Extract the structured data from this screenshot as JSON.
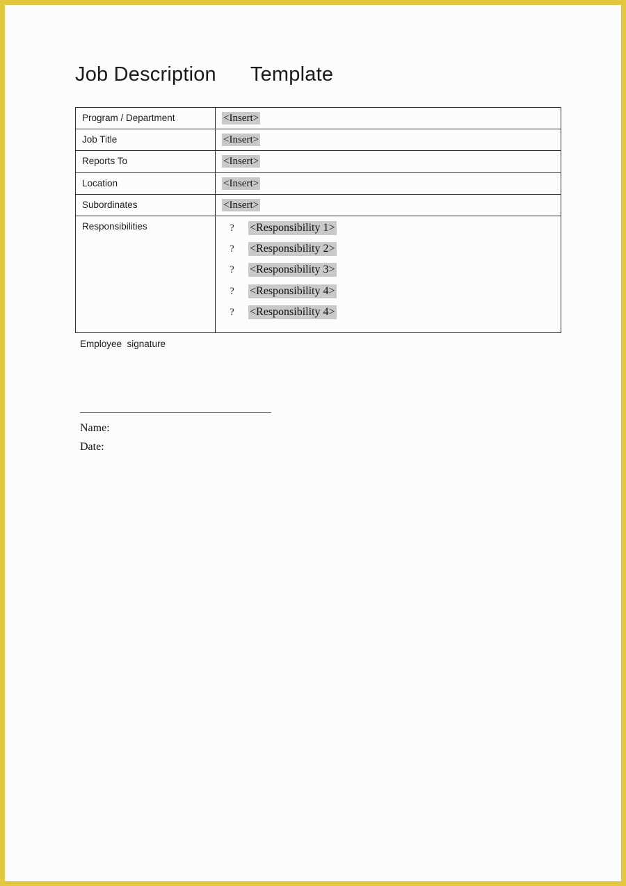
{
  "document": {
    "title": "Job Description      Template",
    "page_background": "#fcfcfc",
    "border_color": "#e3c83f",
    "highlight_color": "#c9c9c9"
  },
  "table": {
    "rows": [
      {
        "label": "Program / Department",
        "value": "<Insert>"
      },
      {
        "label": "Job Title",
        "value": "<Insert>"
      },
      {
        "label": "Reports To",
        "value": "<Insert>"
      },
      {
        "label": "Location",
        "value": "<Insert>"
      },
      {
        "label": "Subordinates",
        "value": "<Insert>"
      }
    ],
    "responsibilities": {
      "label": "Responsibilities",
      "bullet_glyph": "?",
      "items": [
        "<Responsibility 1>",
        "<Responsibility 2>",
        "<Responsibility 3>",
        "<Responsibility 4>",
        "<Responsibility 4>"
      ]
    }
  },
  "signature": {
    "label": "Employee  signature",
    "line": "",
    "name_label": "Name:",
    "date_label": "Date:"
  },
  "watermark": {
    "text": "www.thetemplatemarket.com"
  }
}
